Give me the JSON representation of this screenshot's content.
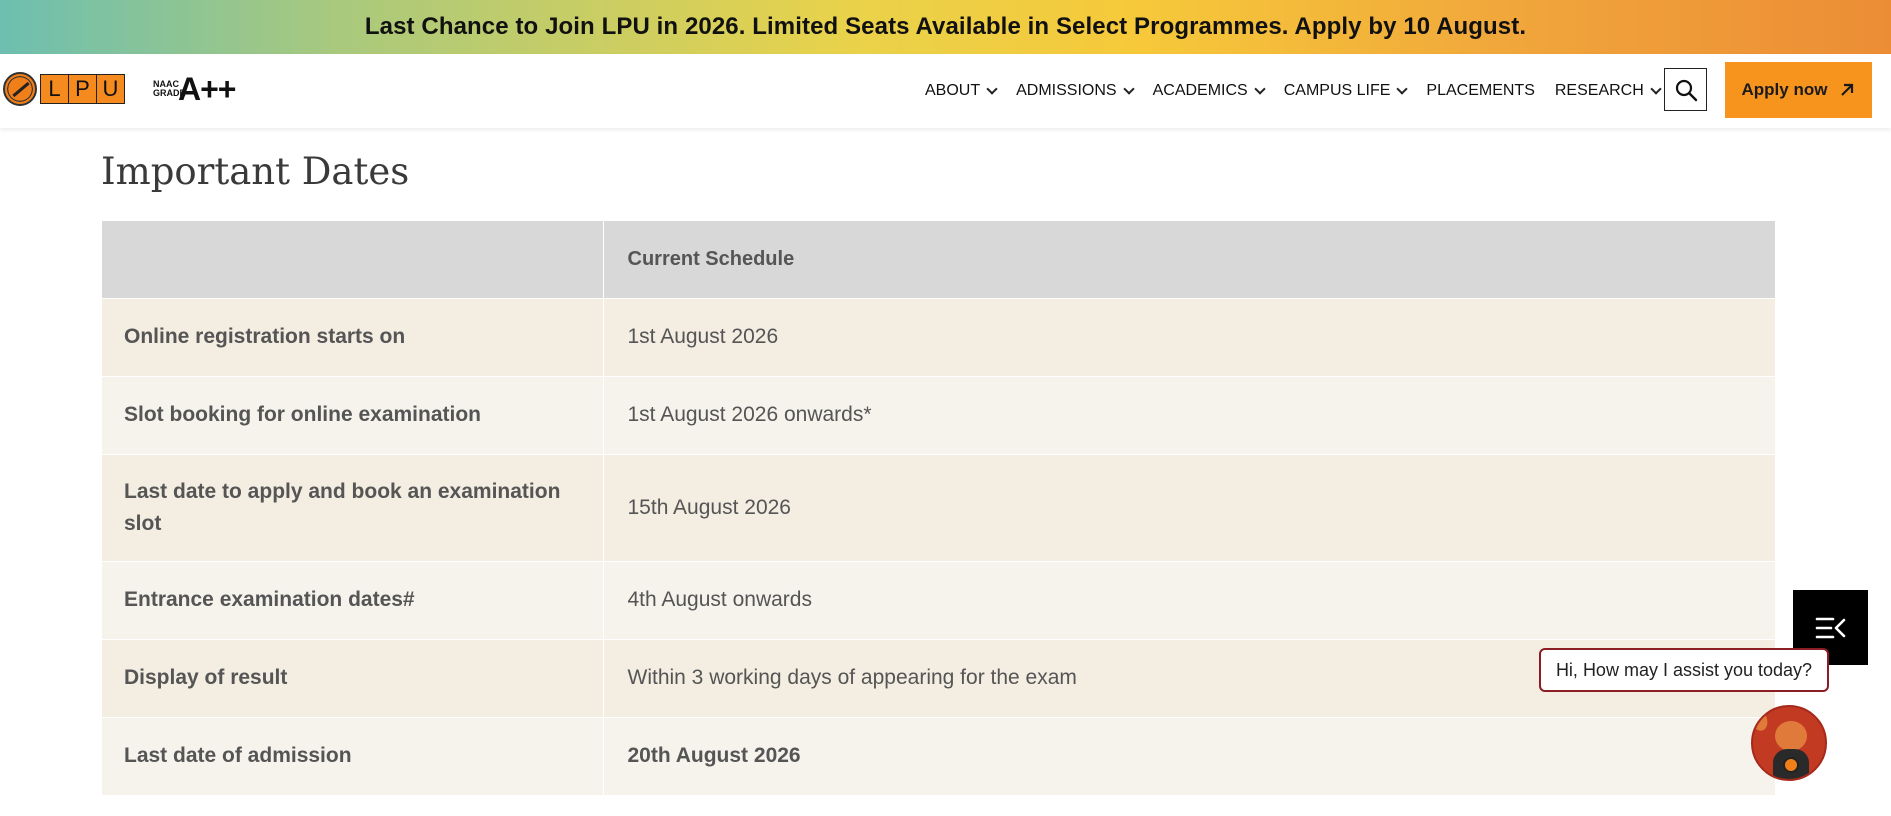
{
  "promo": {
    "text": "Last Chance to Join LPU in 2026. Limited Seats Available in Select Programmes. Apply by 10 August."
  },
  "header": {
    "logo_letters": [
      "L",
      "P",
      "U"
    ],
    "naac": {
      "small": "NAAC GRADE",
      "grade": "A++"
    },
    "nav": [
      {
        "label": "ABOUT",
        "dropdown": true
      },
      {
        "label": "ADMISSIONS",
        "dropdown": true
      },
      {
        "label": "ACADEMICS",
        "dropdown": true
      },
      {
        "label": "CAMPUS LIFE",
        "dropdown": true
      },
      {
        "label": "PLACEMENTS",
        "dropdown": false
      },
      {
        "label": "RESEARCH",
        "dropdown": true
      }
    ],
    "search_icon": "search-icon",
    "apply_label": "Apply now",
    "apply_icon": "arrow-up-right-icon",
    "colors": {
      "accent": "#f7941d"
    }
  },
  "main": {
    "title": "Important Dates",
    "table": {
      "headers": [
        "",
        "Current Schedule"
      ],
      "rows": [
        {
          "event": "Online registration starts on",
          "date": "1st August 2026"
        },
        {
          "event": "Slot booking for online examination",
          "date": "1st August 2026 onwards*"
        },
        {
          "event": "Last date to apply and book an examination slot",
          "date": "15th August 2026"
        },
        {
          "event": "Entrance examination dates#",
          "date": "4th August onwards"
        },
        {
          "event": "Display of result",
          "date": "Within 3 working days of appearing for the exam"
        },
        {
          "event": "Last date of admission",
          "date": "20th August 2026"
        }
      ]
    }
  },
  "widgets": {
    "menu_icon": "menu-collapse-icon",
    "chat_text": "Hi, How may I assist you today?",
    "mascot": "chatbot-mascot-icon"
  }
}
